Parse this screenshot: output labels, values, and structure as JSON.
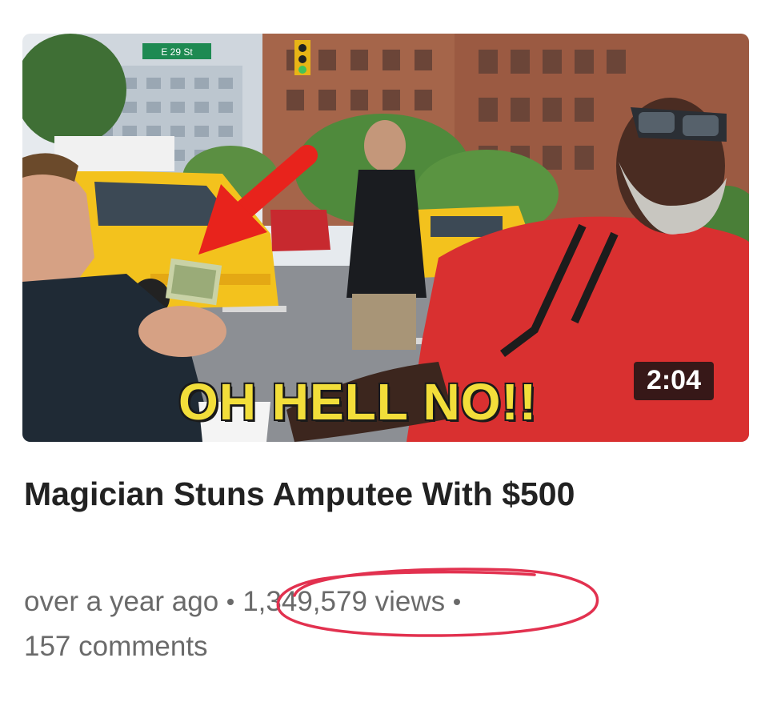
{
  "video": {
    "thumbnail_caption": "OH HELL NO!!",
    "duration": "2:04",
    "title": "Magician Stuns Amputee With $500",
    "posted": "over a year ago",
    "views": "1,349,579 views",
    "comments": "157 comments",
    "street_sign": "E 29 St"
  },
  "annotation": {
    "color": "#e2314f",
    "shape": "hand-drawn-ellipse"
  },
  "colors": {
    "caption_fill": "#f2de3a",
    "arrow": "#e8231c",
    "taxi": "#f3c21d",
    "shirt_red": "#d93030"
  }
}
